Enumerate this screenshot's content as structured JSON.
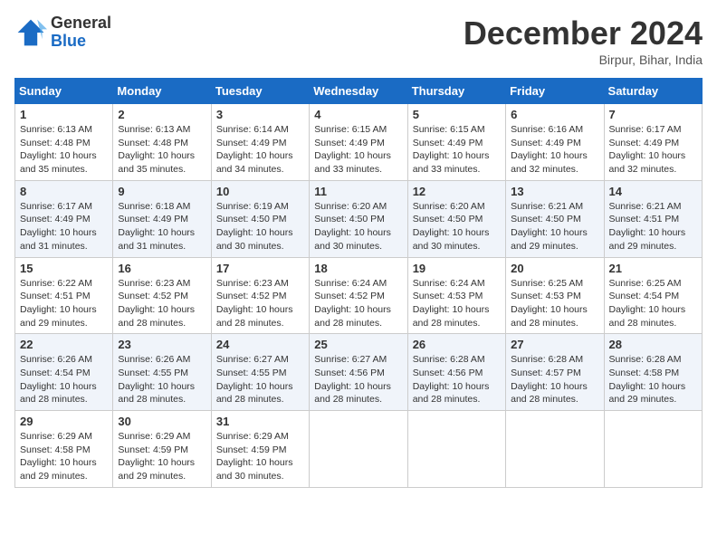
{
  "header": {
    "logo": {
      "general": "General",
      "blue": "Blue"
    },
    "title": "December 2024",
    "subtitle": "Birpur, Bihar, India"
  },
  "calendar": {
    "days_of_week": [
      "Sunday",
      "Monday",
      "Tuesday",
      "Wednesday",
      "Thursday",
      "Friday",
      "Saturday"
    ],
    "weeks": [
      [
        null,
        {
          "day": "2",
          "sunrise": "6:13 AM",
          "sunset": "4:48 PM",
          "daylight": "10 hours and 35 minutes."
        },
        {
          "day": "3",
          "sunrise": "6:14 AM",
          "sunset": "4:49 PM",
          "daylight": "10 hours and 34 minutes."
        },
        {
          "day": "4",
          "sunrise": "6:15 AM",
          "sunset": "4:49 PM",
          "daylight": "10 hours and 33 minutes."
        },
        {
          "day": "5",
          "sunrise": "6:15 AM",
          "sunset": "4:49 PM",
          "daylight": "10 hours and 33 minutes."
        },
        {
          "day": "6",
          "sunrise": "6:16 AM",
          "sunset": "4:49 PM",
          "daylight": "10 hours and 32 minutes."
        },
        {
          "day": "7",
          "sunrise": "6:17 AM",
          "sunset": "4:49 PM",
          "daylight": "10 hours and 32 minutes."
        }
      ],
      [
        {
          "day": "1",
          "sunrise": "6:13 AM",
          "sunset": "4:48 PM",
          "daylight": "10 hours and 35 minutes."
        },
        {
          "day": "8",
          "sunrise": "6:17 AM",
          "sunset": "4:49 PM",
          "daylight": "10 hours and 31 minutes."
        },
        {
          "day": "9",
          "sunrise": "6:18 AM",
          "sunset": "4:49 PM",
          "daylight": "10 hours and 31 minutes."
        },
        {
          "day": "10",
          "sunrise": "6:19 AM",
          "sunset": "4:50 PM",
          "daylight": "10 hours and 30 minutes."
        },
        {
          "day": "11",
          "sunrise": "6:20 AM",
          "sunset": "4:50 PM",
          "daylight": "10 hours and 30 minutes."
        },
        {
          "day": "12",
          "sunrise": "6:20 AM",
          "sunset": "4:50 PM",
          "daylight": "10 hours and 30 minutes."
        },
        {
          "day": "13",
          "sunrise": "6:21 AM",
          "sunset": "4:50 PM",
          "daylight": "10 hours and 29 minutes."
        },
        {
          "day": "14",
          "sunrise": "6:21 AM",
          "sunset": "4:51 PM",
          "daylight": "10 hours and 29 minutes."
        }
      ],
      [
        {
          "day": "15",
          "sunrise": "6:22 AM",
          "sunset": "4:51 PM",
          "daylight": "10 hours and 29 minutes."
        },
        {
          "day": "16",
          "sunrise": "6:23 AM",
          "sunset": "4:52 PM",
          "daylight": "10 hours and 28 minutes."
        },
        {
          "day": "17",
          "sunrise": "6:23 AM",
          "sunset": "4:52 PM",
          "daylight": "10 hours and 28 minutes."
        },
        {
          "day": "18",
          "sunrise": "6:24 AM",
          "sunset": "4:52 PM",
          "daylight": "10 hours and 28 minutes."
        },
        {
          "day": "19",
          "sunrise": "6:24 AM",
          "sunset": "4:53 PM",
          "daylight": "10 hours and 28 minutes."
        },
        {
          "day": "20",
          "sunrise": "6:25 AM",
          "sunset": "4:53 PM",
          "daylight": "10 hours and 28 minutes."
        },
        {
          "day": "21",
          "sunrise": "6:25 AM",
          "sunset": "4:54 PM",
          "daylight": "10 hours and 28 minutes."
        }
      ],
      [
        {
          "day": "22",
          "sunrise": "6:26 AM",
          "sunset": "4:54 PM",
          "daylight": "10 hours and 28 minutes."
        },
        {
          "day": "23",
          "sunrise": "6:26 AM",
          "sunset": "4:55 PM",
          "daylight": "10 hours and 28 minutes."
        },
        {
          "day": "24",
          "sunrise": "6:27 AM",
          "sunset": "4:55 PM",
          "daylight": "10 hours and 28 minutes."
        },
        {
          "day": "25",
          "sunrise": "6:27 AM",
          "sunset": "4:56 PM",
          "daylight": "10 hours and 28 minutes."
        },
        {
          "day": "26",
          "sunrise": "6:28 AM",
          "sunset": "4:56 PM",
          "daylight": "10 hours and 28 minutes."
        },
        {
          "day": "27",
          "sunrise": "6:28 AM",
          "sunset": "4:57 PM",
          "daylight": "10 hours and 28 minutes."
        },
        {
          "day": "28",
          "sunrise": "6:28 AM",
          "sunset": "4:58 PM",
          "daylight": "10 hours and 29 minutes."
        }
      ],
      [
        {
          "day": "29",
          "sunrise": "6:29 AM",
          "sunset": "4:58 PM",
          "daylight": "10 hours and 29 minutes."
        },
        {
          "day": "30",
          "sunrise": "6:29 AM",
          "sunset": "4:59 PM",
          "daylight": "10 hours and 29 minutes."
        },
        {
          "day": "31",
          "sunrise": "6:29 AM",
          "sunset": "4:59 PM",
          "daylight": "10 hours and 30 minutes."
        },
        null,
        null,
        null,
        null
      ]
    ]
  }
}
